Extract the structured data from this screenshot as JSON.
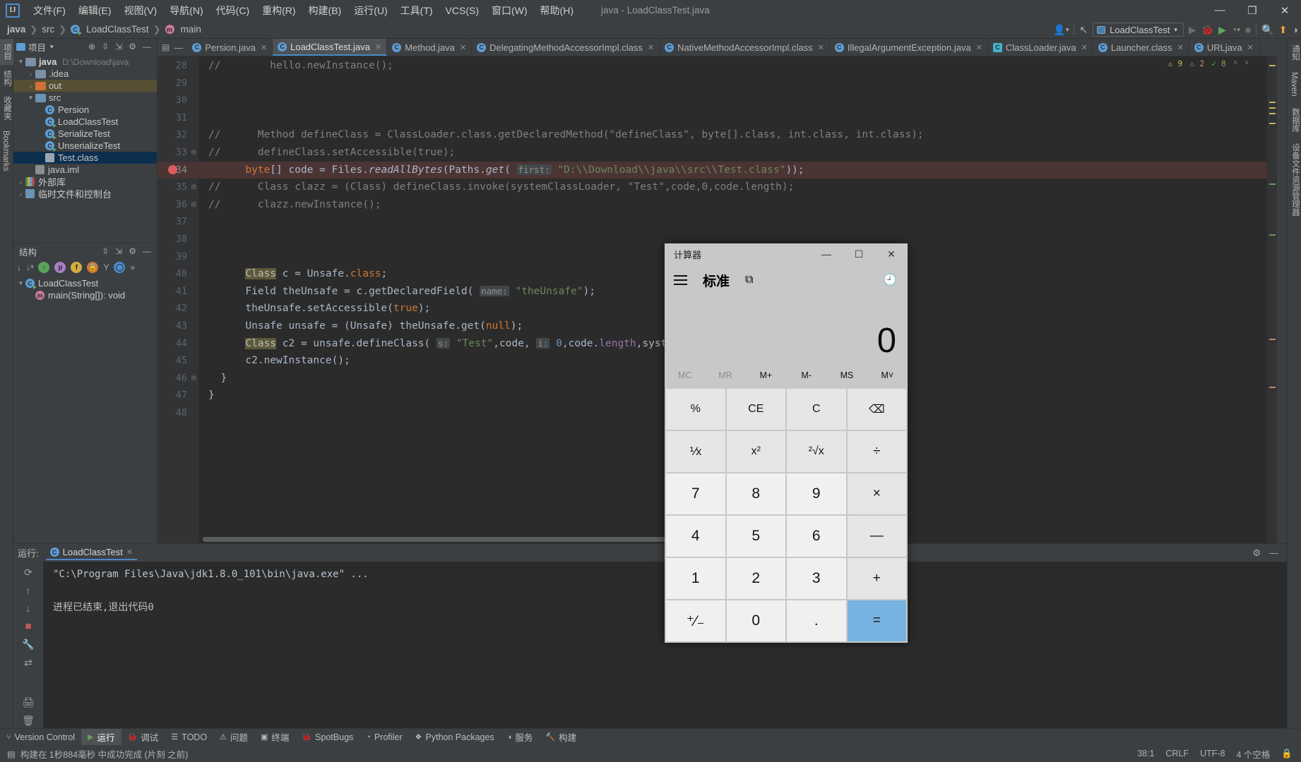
{
  "titlebar": {
    "logo": "IJ",
    "menus": [
      "文件(F)",
      "编辑(E)",
      "视图(V)",
      "导航(N)",
      "代码(C)",
      "重构(R)",
      "构建(B)",
      "运行(U)",
      "工具(T)",
      "VCS(S)",
      "窗口(W)",
      "帮助(H)"
    ],
    "window_title": "java - LoadClassTest.java",
    "minimize": "—",
    "maximize": "❐",
    "close": "✕"
  },
  "navbar": {
    "breadcrumbs": [
      "java",
      "src",
      "LoadClassTest",
      "main"
    ],
    "separator": "❯",
    "run_config": "LoadClassTest",
    "dropdown": "▾",
    "icons": {
      "people": "👤",
      "updates": "↖",
      "run": "▶",
      "debug": "🐞",
      "coverage": "▶",
      "profile": "⏱",
      "stop": "■",
      "search": "🔍",
      "notify": "↑",
      "theme": "◑"
    }
  },
  "left_stripe": [
    "项目",
    "结构",
    "收藏夹",
    "Bookmarks"
  ],
  "right_stripe": [
    "通知",
    "Maven",
    "数据库",
    "设备文件资源管理器"
  ],
  "project_panel": {
    "title": "项目",
    "chevron": "▾",
    "tools": [
      "⊕",
      "⇥",
      "⇤",
      "⚙",
      "—"
    ],
    "tree": [
      {
        "label": "java",
        "suffix": "D:\\Download\\java",
        "depth": 0,
        "arrow": "▾",
        "icon": "module",
        "bold": true,
        "state": "normal"
      },
      {
        "label": ".idea",
        "depth": 1,
        "arrow": "›",
        "icon": "folder",
        "state": "normal"
      },
      {
        "label": "out",
        "depth": 1,
        "arrow": "›",
        "icon": "folder-orange",
        "state": "highlight"
      },
      {
        "label": "src",
        "depth": 1,
        "arrow": "▾",
        "icon": "folder-blue",
        "state": "normal"
      },
      {
        "label": "Persion",
        "depth": 2,
        "arrow": "",
        "icon": "class",
        "state": "normal"
      },
      {
        "label": "LoadClassTest",
        "depth": 2,
        "arrow": "",
        "icon": "class-run",
        "state": "normal"
      },
      {
        "label": "SerializeTest",
        "depth": 2,
        "arrow": "",
        "icon": "class-run",
        "state": "normal"
      },
      {
        "label": "UnserializeTest",
        "depth": 2,
        "arrow": "",
        "icon": "class-run",
        "state": "normal"
      },
      {
        "label": "Test.class",
        "depth": 2,
        "arrow": "",
        "icon": "classfile",
        "state": "selected"
      },
      {
        "label": "java.iml",
        "depth": 1,
        "arrow": "",
        "icon": "iml",
        "state": "normal"
      },
      {
        "label": "外部库",
        "depth": 0,
        "arrow": "›",
        "icon": "lib",
        "state": "normal"
      },
      {
        "label": "临时文件和控制台",
        "depth": 0,
        "arrow": "›",
        "icon": "scratch",
        "state": "normal"
      }
    ]
  },
  "structure_panel": {
    "title": "结构",
    "tools": [
      "⇥",
      "⇤",
      "⚙",
      "—"
    ],
    "filters": [
      "↓",
      "↓ᵃ",
      "ⓘ",
      "ⓟ",
      "ⓕ",
      "🔒",
      "Y",
      "◯",
      "»"
    ],
    "items": [
      {
        "label": "LoadClassTest",
        "depth": 0,
        "arrow": "▾",
        "icon": "class-run"
      },
      {
        "label": "main(String[]): void",
        "depth": 1,
        "arrow": "",
        "icon": "method"
      }
    ]
  },
  "editor": {
    "tabs": [
      {
        "label": "Persion.java",
        "icon": "class",
        "active": false
      },
      {
        "label": "LoadClassTest.java",
        "icon": "class-run",
        "active": true
      },
      {
        "label": "Method.java",
        "icon": "class-lib",
        "active": false
      },
      {
        "label": "DelegatingMethodAccessorImpl.class",
        "icon": "class",
        "active": false
      },
      {
        "label": "NativeMethodAccessorImpl.class",
        "icon": "class",
        "active": false
      },
      {
        "label": "IllegalArgumentException.java",
        "icon": "class",
        "active": false
      },
      {
        "label": "ClassLoader.java",
        "icon": "class-sq",
        "active": false
      },
      {
        "label": "Launcher.class",
        "icon": "class",
        "active": false
      },
      {
        "label": "URLjava",
        "icon": "class",
        "active": false
      }
    ],
    "close_glyph": "✕",
    "inspections": {
      "warnings": "9",
      "errors": "2",
      "ok": "8",
      "warn_glyph": "⚠",
      "err_glyph": "⚠",
      "ok_glyph": "✓",
      "up": "˄",
      "down": "˅"
    },
    "lines": [
      {
        "n": "28",
        "fold": "",
        "bp": false,
        "hl": false,
        "tokens": [
          {
            "t": "//",
            "c": "cmt"
          },
          {
            "t": "        hello.newInstance();",
            "c": "cmt"
          }
        ]
      },
      {
        "n": "29",
        "fold": "",
        "bp": false,
        "hl": false,
        "tokens": []
      },
      {
        "n": "30",
        "fold": "",
        "bp": false,
        "hl": false,
        "tokens": []
      },
      {
        "n": "31",
        "fold": "",
        "bp": false,
        "hl": false,
        "tokens": []
      },
      {
        "n": "32",
        "fold": "",
        "bp": false,
        "hl": false,
        "tokens": [
          {
            "t": "//      Method defineClass = ClassLoader.class.getDeclaredMethod(\"defineClass\", byte[].class, int.class, int.class);",
            "c": "cmt"
          }
        ]
      },
      {
        "n": "33",
        "fold": "⊟",
        "bp": false,
        "hl": false,
        "tokens": [
          {
            "t": "//      defineClass.setAccessible(true);",
            "c": "cmt"
          }
        ]
      },
      {
        "n": "34",
        "fold": "",
        "bp": true,
        "hl": true,
        "tokens": [
          {
            "t": "      ",
            "c": "plain"
          },
          {
            "t": "byte",
            "c": "kw"
          },
          {
            "t": "[] code = Files.",
            "c": "plain"
          },
          {
            "t": "readAllBytes",
            "c": "stat"
          },
          {
            "t": "(Paths.",
            "c": "plain"
          },
          {
            "t": "get",
            "c": "stat"
          },
          {
            "t": "( ",
            "c": "plain"
          },
          {
            "t": "first:",
            "c": "hint"
          },
          {
            "t": " ",
            "c": "plain"
          },
          {
            "t": "\"D:\\\\Download\\\\java\\\\src\\\\Test.class\"",
            "c": "str"
          },
          {
            "t": "));",
            "c": "plain"
          }
        ]
      },
      {
        "n": "35",
        "fold": "⊟",
        "bp": false,
        "hl": false,
        "tokens": [
          {
            "t": "//      Class clazz = (Class) defineClass.invoke(systemClassLoader, \"Test\",code,0,code.length);",
            "c": "cmt"
          }
        ]
      },
      {
        "n": "36",
        "fold": "⊟",
        "bp": false,
        "hl": false,
        "tokens": [
          {
            "t": "//      clazz.newInstance();",
            "c": "cmt"
          }
        ]
      },
      {
        "n": "37",
        "fold": "",
        "bp": false,
        "hl": false,
        "tokens": []
      },
      {
        "n": "38",
        "fold": "",
        "bp": false,
        "hl": false,
        "tokens": []
      },
      {
        "n": "39",
        "fold": "",
        "bp": false,
        "hl": false,
        "tokens": []
      },
      {
        "n": "40",
        "fold": "",
        "bp": false,
        "hl": false,
        "tokens": [
          {
            "t": "      ",
            "c": "plain"
          },
          {
            "t": "Class",
            "c": "sel-word"
          },
          {
            "t": " c = Unsafe.",
            "c": "plain"
          },
          {
            "t": "class",
            "c": "kw"
          },
          {
            "t": ";",
            "c": "plain"
          }
        ]
      },
      {
        "n": "41",
        "fold": "",
        "bp": false,
        "hl": false,
        "tokens": [
          {
            "t": "      Field theUnsafe = c.getDeclaredField( ",
            "c": "plain"
          },
          {
            "t": "name:",
            "c": "hint"
          },
          {
            "t": " ",
            "c": "plain"
          },
          {
            "t": "\"theUnsafe\"",
            "c": "str"
          },
          {
            "t": ");",
            "c": "plain"
          }
        ]
      },
      {
        "n": "42",
        "fold": "",
        "bp": false,
        "hl": false,
        "tokens": [
          {
            "t": "      theUnsafe.setAccessible(",
            "c": "plain"
          },
          {
            "t": "true",
            "c": "kw"
          },
          {
            "t": ");",
            "c": "plain"
          }
        ]
      },
      {
        "n": "43",
        "fold": "",
        "bp": false,
        "hl": false,
        "tokens": [
          {
            "t": "      Unsafe unsafe = (Unsafe) theUnsafe.get(",
            "c": "plain"
          },
          {
            "t": "null",
            "c": "kw"
          },
          {
            "t": ");",
            "c": "plain"
          }
        ]
      },
      {
        "n": "44",
        "fold": "",
        "bp": false,
        "hl": false,
        "tokens": [
          {
            "t": "      ",
            "c": "plain"
          },
          {
            "t": "Class",
            "c": "sel-word"
          },
          {
            "t": " c2 = unsafe.defineClass( ",
            "c": "plain"
          },
          {
            "t": "s:",
            "c": "hint"
          },
          {
            "t": " ",
            "c": "plain"
          },
          {
            "t": "\"Test\"",
            "c": "str"
          },
          {
            "t": ",code, ",
            "c": "plain"
          },
          {
            "t": "i:",
            "c": "hint"
          },
          {
            "t": " ",
            "c": "plain"
          },
          {
            "t": "0",
            "c": "num2"
          },
          {
            "t": ",code.",
            "c": "plain"
          },
          {
            "t": "length",
            "c": "fld"
          },
          {
            "t": ",systemCl",
            "c": "plain"
          }
        ]
      },
      {
        "n": "45",
        "fold": "",
        "bp": false,
        "hl": false,
        "tokens": [
          {
            "t": "      c2.newInstance();",
            "c": "plain"
          }
        ]
      },
      {
        "n": "46",
        "fold": "⊟",
        "bp": false,
        "hl": false,
        "tokens": [
          {
            "t": "  }",
            "c": "plain"
          }
        ]
      },
      {
        "n": "47",
        "fold": "",
        "bp": false,
        "hl": false,
        "tokens": [
          {
            "t": "}",
            "c": "plain"
          }
        ]
      },
      {
        "n": "48",
        "fold": "",
        "bp": false,
        "hl": false,
        "tokens": []
      }
    ]
  },
  "run_panel": {
    "label": "运行:",
    "tab": "LoadClassTest",
    "close": "✕",
    "tools": [
      "⟳",
      "↑",
      "↓",
      "■",
      "🔧",
      "⌦"
    ],
    "header_icons": [
      "⚙",
      "—"
    ],
    "console_command": "\"C:\\Program Files\\Java\\jdk1.8.0_101\\bin\\java.exe\" ...",
    "console_output": "进程已结束,退出代码0"
  },
  "bottom_bar": {
    "items": [
      {
        "label": "Version Control",
        "icon": "⑂",
        "active": false
      },
      {
        "label": "运行",
        "icon": "▶",
        "active": true
      },
      {
        "label": "调试",
        "icon": "🐞",
        "active": false
      },
      {
        "label": "TODO",
        "icon": "☰",
        "active": false
      },
      {
        "label": "问题",
        "icon": "⚠",
        "active": false
      },
      {
        "label": "终端",
        "icon": "▣",
        "active": false
      },
      {
        "label": "SpotBugs",
        "icon": "🐞",
        "active": false
      },
      {
        "label": "Profiler",
        "icon": "◔",
        "active": false
      },
      {
        "label": "Python Packages",
        "icon": "❖",
        "active": false
      },
      {
        "label": "服务",
        "icon": "◑",
        "active": false
      },
      {
        "label": "构建",
        "icon": "🔨",
        "active": false
      }
    ]
  },
  "status_bar": {
    "icon": "📄",
    "message": "构建在 1秒884毫秒 中成功完成 (片刻 之前)",
    "caret": "38:1",
    "line_sep": "CRLF",
    "encoding": "UTF-8",
    "indent": "4 个空格",
    "lock": "🔒"
  },
  "calculator": {
    "title": "计算器",
    "minimize": "—",
    "maximize": "☐",
    "close": "✕",
    "mode": "标准",
    "keep_on_top_icon": "⧉",
    "history_icon": "🕘",
    "display": "0",
    "memory": [
      {
        "label": "MC",
        "enabled": false
      },
      {
        "label": "MR",
        "enabled": false
      },
      {
        "label": "M+",
        "enabled": true
      },
      {
        "label": "M-",
        "enabled": true
      },
      {
        "label": "MS",
        "enabled": true
      },
      {
        "label": "M˅",
        "enabled": true
      }
    ],
    "keys": [
      {
        "label": "%",
        "kind": "fn"
      },
      {
        "label": "CE",
        "kind": "fn"
      },
      {
        "label": "C",
        "kind": "fn"
      },
      {
        "label": "⌫",
        "kind": "fn"
      },
      {
        "label": "⅟x",
        "kind": "fn"
      },
      {
        "label": "x²",
        "kind": "fn"
      },
      {
        "label": "²√x",
        "kind": "fn"
      },
      {
        "label": "÷",
        "kind": "op"
      },
      {
        "label": "7",
        "kind": "num"
      },
      {
        "label": "8",
        "kind": "num"
      },
      {
        "label": "9",
        "kind": "num"
      },
      {
        "label": "×",
        "kind": "op"
      },
      {
        "label": "4",
        "kind": "num"
      },
      {
        "label": "5",
        "kind": "num"
      },
      {
        "label": "6",
        "kind": "num"
      },
      {
        "label": "—",
        "kind": "op"
      },
      {
        "label": "1",
        "kind": "num"
      },
      {
        "label": "2",
        "kind": "num"
      },
      {
        "label": "3",
        "kind": "num"
      },
      {
        "label": "+",
        "kind": "op"
      },
      {
        "label": "⁺∕₋",
        "kind": "num"
      },
      {
        "label": "0",
        "kind": "num"
      },
      {
        "label": ".",
        "kind": "num"
      },
      {
        "label": "=",
        "kind": "eq"
      }
    ]
  },
  "colors": {
    "accent": "#4a88c7",
    "editor_bg": "#2b2b2b",
    "panel_bg": "#3c3f41",
    "calc_accent": "#76b3e0",
    "breakpoint": "#db5c5c"
  }
}
